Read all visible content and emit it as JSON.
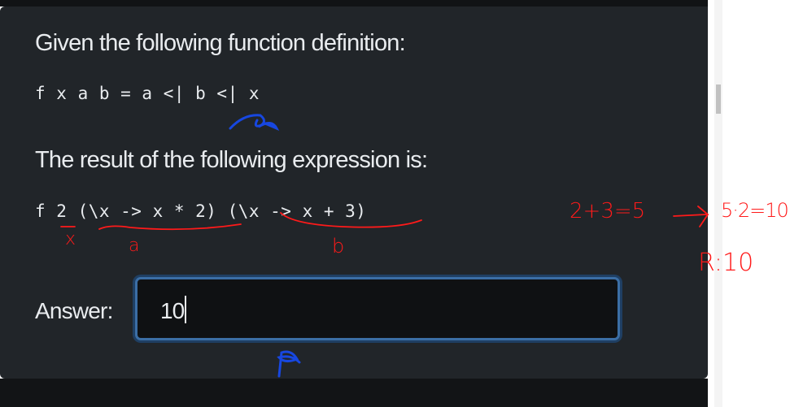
{
  "question": {
    "prompt_1": "Given the following function definition:",
    "definition": "f x a b = a <| b <| x",
    "prompt_2": "The result of the following expression is:",
    "expression": "f 2 (\\x -> x * 2) (\\x -> x + 3)"
  },
  "answer": {
    "label": "Answer:",
    "value": "10"
  },
  "annotations": {
    "under_x": "x",
    "under_a": "a",
    "under_b": "b",
    "step_1": "2+3=5",
    "step_2": "5·2=10",
    "result": "R:10"
  },
  "colors": {
    "panel_bg": "#212529",
    "text": "#e9ecef",
    "input_border": "#3b6ea5",
    "annotation_red": "#ff1a1a",
    "annotation_blue": "#1747e0"
  }
}
